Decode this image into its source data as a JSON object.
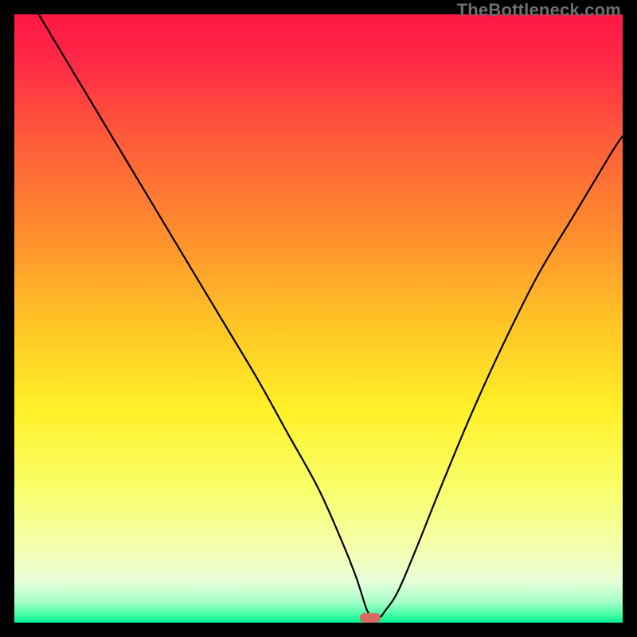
{
  "watermark": "TheBottleneck.com",
  "chart_data": {
    "type": "line",
    "title": "",
    "xlabel": "",
    "ylabel": "",
    "xlim": [
      0,
      100
    ],
    "ylim": [
      0,
      100
    ],
    "grid": false,
    "legend": false,
    "background": {
      "style": "vertical-gradient",
      "stops": [
        {
          "offset": 0.0,
          "color": "#ff1744"
        },
        {
          "offset": 0.08,
          "color": "#ff2a46"
        },
        {
          "offset": 0.2,
          "color": "#ff5a3a"
        },
        {
          "offset": 0.35,
          "color": "#ff8a2e"
        },
        {
          "offset": 0.5,
          "color": "#ffc226"
        },
        {
          "offset": 0.65,
          "color": "#fff028"
        },
        {
          "offset": 0.78,
          "color": "#f9ff6a"
        },
        {
          "offset": 0.88,
          "color": "#f4ffb0"
        },
        {
          "offset": 0.93,
          "color": "#eaffd8"
        },
        {
          "offset": 0.965,
          "color": "#a7ffc9"
        },
        {
          "offset": 0.985,
          "color": "#4fffa8"
        },
        {
          "offset": 1.0,
          "color": "#00f091"
        }
      ]
    },
    "series": [
      {
        "name": "bottleneck-curve",
        "x": [
          4,
          10,
          16,
          22,
          28,
          34,
          40,
          45,
          50,
          54,
          56,
          57,
          58,
          59,
          60,
          61,
          63,
          66,
          70,
          75,
          80,
          86,
          92,
          98,
          100
        ],
        "y": [
          100,
          90,
          80,
          70,
          60,
          50,
          40,
          31,
          22,
          13,
          8,
          5,
          2,
          0.8,
          0.8,
          2,
          5,
          12,
          22,
          34,
          45,
          57,
          67,
          77,
          80
        ]
      }
    ],
    "marker": {
      "name": "optimal-point",
      "x": 58.5,
      "y": 0.8,
      "color": "#d86a64",
      "shape": "rounded-rect"
    }
  }
}
